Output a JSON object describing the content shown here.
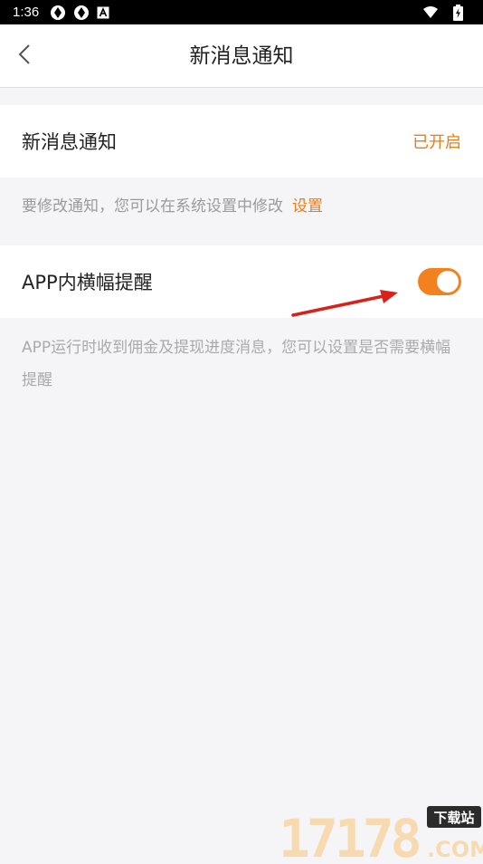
{
  "status_bar": {
    "time": "1:36",
    "icons": [
      "aperture-icon",
      "aperture-icon",
      "font-a-icon",
      "wifi-icon",
      "battery-charging-icon"
    ]
  },
  "navbar": {
    "back_icon": "chevron-left-icon",
    "title": "新消息通知"
  },
  "notification_setting": {
    "label": "新消息通知",
    "status": "已开启",
    "hint": "要修改通知，您可以在系统设置中修改",
    "hint_link": "设置"
  },
  "banner_setting": {
    "label": "APP内横幅提醒",
    "enabled": true,
    "hint": "APP运行时收到佣金及提现进度消息，您可以设置是否需要横幅提醒"
  },
  "watermark": {
    "digits": "17178",
    "tag": "下载站",
    "suffix": ".COM"
  },
  "colors": {
    "accent": "#f07a14",
    "toggle_on": "#f48120",
    "arrow": "#d8201c",
    "background": "#f5f5f7"
  }
}
